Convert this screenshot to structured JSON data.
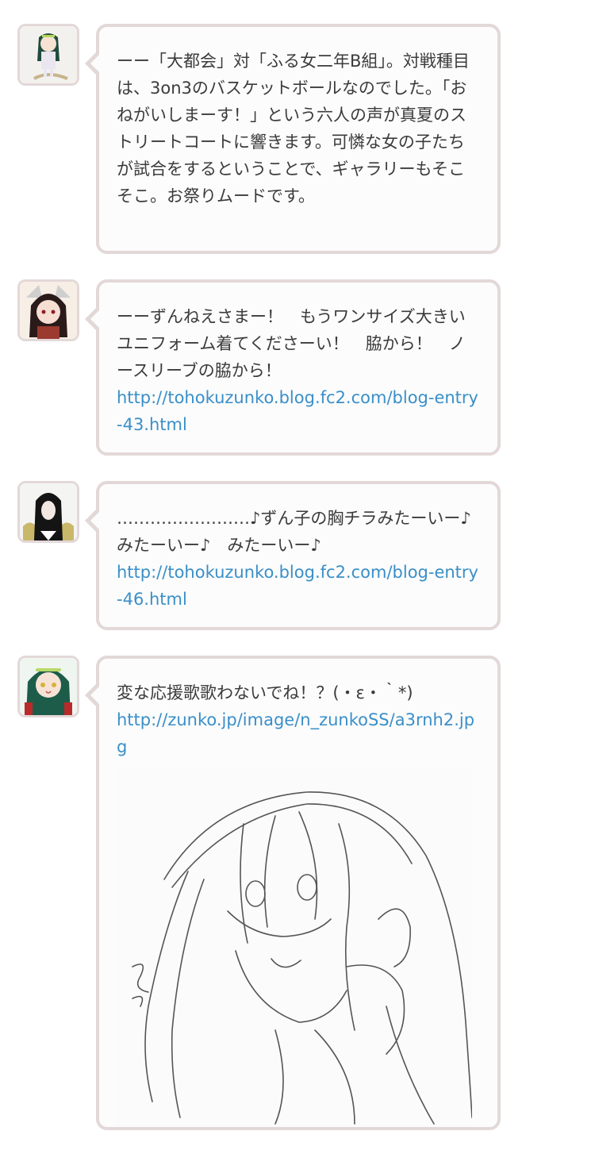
{
  "messages": [
    {
      "avatar": "character-avatar-1",
      "text": "ーー「大都会」対「ふる女二年B組」。対戦種目は、3on3のバスケットボールなのでした。「おねがいしまーす！」という六人の声が真夏のストリートコートに響きます。可憐な女の子たちが試合をするということで、ギャラリーもそこそこ。お祭りムードです。",
      "link": ""
    },
    {
      "avatar": "character-avatar-2",
      "text": "ーーずんねえさまー！　もうワンサイズ大きいユニフォーム着てくださーい！　脇から！　ノースリーブの脇から！",
      "link": "http://tohokuzunko.blog.fc2.com/blog-entry-43.html"
    },
    {
      "avatar": "character-avatar-3",
      "text": "……………………♪ずん子の胸チラみたーいー♪　みたーいー♪　みたーいー♪",
      "link": "http://tohokuzunko.blog.fc2.com/blog-entry-46.html"
    },
    {
      "avatar": "character-avatar-4",
      "text": "変な応援歌歌わないでね！？(・ε・｀*)",
      "link": "http://zunko.jp/image/n_zunkoSS/a3rnh2.jpg",
      "image": "character-sketch-image"
    }
  ],
  "colors": {
    "bubble_border": "#e3d8d8",
    "link": "#3a8fc8",
    "text": "#3b3b3b"
  }
}
